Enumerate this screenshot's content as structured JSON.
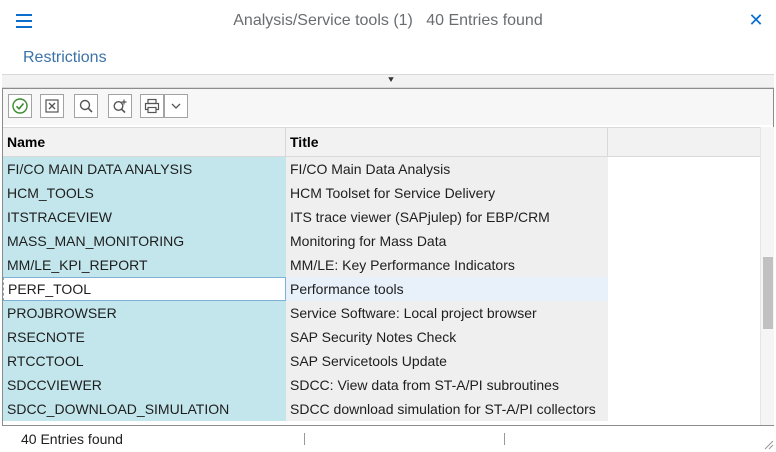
{
  "header": {
    "title": "Analysis/Service tools (1)   40 Entries found",
    "close_symbol": "✕"
  },
  "restrictions_label": "Restrictions",
  "toolbar": {
    "icons": [
      "check-icon",
      "delete-icon",
      "search-icon",
      "search-next-icon",
      "print-icon",
      "chevron-down-icon"
    ]
  },
  "table": {
    "columns": [
      "Name",
      "Title",
      ""
    ],
    "rows": [
      {
        "name": "FI/CO MAIN DATA ANALYSIS",
        "title": "FI/CO Main Data Analysis"
      },
      {
        "name": "HCM_TOOLS",
        "title": "HCM Toolset for Service Delivery"
      },
      {
        "name": "ITSTRACEVIEW",
        "title": "ITS trace viewer (SAPjulep) for EBP/CRM"
      },
      {
        "name": "MASS_MAN_MONITORING",
        "title": "Monitoring for Mass Data"
      },
      {
        "name": "MM/LE_KPI_REPORT",
        "title": "MM/LE: Key Performance Indicators"
      },
      {
        "name": "PERF_TOOL",
        "title": "Performance tools"
      },
      {
        "name": "PROJBROWSER",
        "title": "Service Software: Local project browser"
      },
      {
        "name": "RSECNOTE",
        "title": "SAP Security Notes Check"
      },
      {
        "name": "RTCCTOOL",
        "title": "SAP Servicetools Update"
      },
      {
        "name": "SDCCVIEWER",
        "title": "SDCC: View data from ST-A/PI subroutines"
      },
      {
        "name": "SDCC_DOWNLOAD_SIMULATION",
        "title": "SDCC download simulation for ST-A/PI collectors"
      }
    ],
    "selected_row": 5
  },
  "status": {
    "text": "40 Entries found"
  },
  "colors": {
    "accent": "#0a6ed1",
    "name_column_bg": "#c2e6ec",
    "title_column_bg": "#efefef"
  }
}
